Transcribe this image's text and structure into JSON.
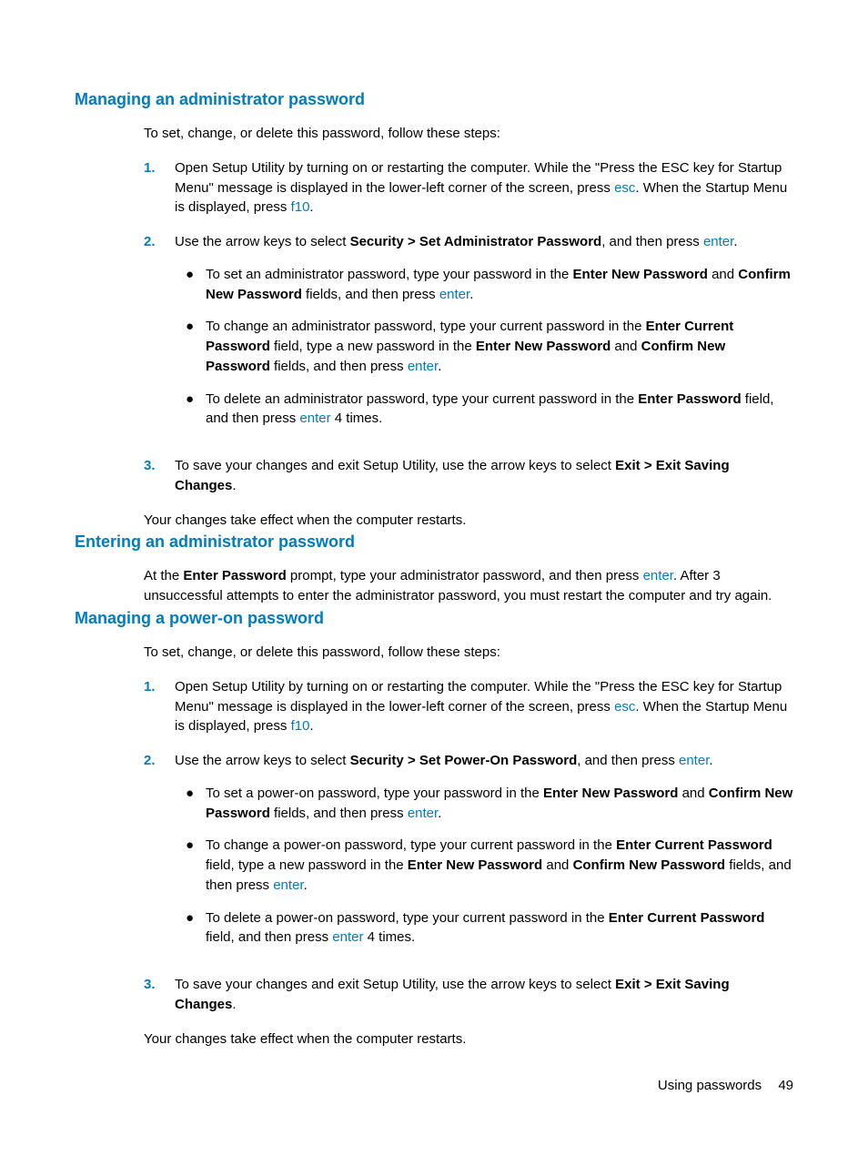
{
  "s1": {
    "title": "Managing an administrator password",
    "intro": "To set, change, or delete this password, follow these steps:",
    "m1": "1.",
    "m2": "2.",
    "m3": "3.",
    "step1_a": "Open Setup Utility by turning on or restarting the computer. While the \"Press the ESC key for Startup Menu\" message is displayed in the lower-left corner of the screen, press ",
    "step1_k1": "esc",
    "step1_b": ". When the Startup Menu is displayed, press ",
    "step1_k2": "f10",
    "step1_c": ".",
    "step2_a": "Use the arrow keys to select ",
    "step2_bold": "Security > Set Administrator Password",
    "step2_b": ", and then press ",
    "step2_k": "enter",
    "step2_c": ".",
    "b1_a": "To set an administrator password, type your password in the ",
    "b1_bold1": "Enter New Password",
    "b1_b": " and ",
    "b1_bold2": "Confirm New Password",
    "b1_c": " fields, and then press ",
    "b1_k": "enter",
    "b1_d": ".",
    "b2_a": "To change an administrator password, type your current password in the ",
    "b2_bold1": "Enter Current Password",
    "b2_b": " field, type a new password in the ",
    "b2_bold2": "Enter New Password",
    "b2_c": " and ",
    "b2_bold3": "Confirm New Password",
    "b2_d": " fields, and then press ",
    "b2_k": "enter",
    "b2_e": ".",
    "b3_a": "To delete an administrator password, type your current password in the ",
    "b3_bold": "Enter Password",
    "b3_b": " field, and then press ",
    "b3_k": "enter",
    "b3_c": " 4 times.",
    "step3_a": "To save your changes and exit Setup Utility, use the arrow keys to select ",
    "step3_bold": "Exit > Exit Saving Changes",
    "step3_b": ".",
    "outro": "Your changes take effect when the computer restarts."
  },
  "s2": {
    "title": "Entering an administrator password",
    "p_a": "At the ",
    "p_bold": "Enter Password",
    "p_b": " prompt, type your administrator password, and then press ",
    "p_k": "enter",
    "p_c": ". After 3 unsuccessful attempts to enter the administrator password, you must restart the computer and try again."
  },
  "s3": {
    "title": "Managing a power-on password",
    "intro": "To set, change, or delete this password, follow these steps:",
    "m1": "1.",
    "m2": "2.",
    "m3": "3.",
    "step1_a": "Open Setup Utility by turning on or restarting the computer. While the \"Press the ESC key for Startup Menu\" message is displayed in the lower-left corner of the screen, press ",
    "step1_k1": "esc",
    "step1_b": ". When the Startup Menu is displayed, press ",
    "step1_k2": "f10",
    "step1_c": ".",
    "step2_a": "Use the arrow keys to select ",
    "step2_bold": "Security > Set Power-On Password",
    "step2_b": ", and then press ",
    "step2_k": "enter",
    "step2_c": ".",
    "b1_a": "To set a power-on password, type your password in the ",
    "b1_bold1": "Enter New Password",
    "b1_b": " and ",
    "b1_bold2": "Confirm New Password",
    "b1_c": " fields, and then press ",
    "b1_k": "enter",
    "b1_d": ".",
    "b2_a": "To change a power-on password, type your current password in the ",
    "b2_bold1": "Enter Current Password",
    "b2_b": " field, type a new password in the ",
    "b2_bold2": "Enter New Password",
    "b2_c": " and ",
    "b2_bold3": "Confirm New Password",
    "b2_d": " fields, and then press ",
    "b2_k": "enter",
    "b2_e": ".",
    "b3_a": "To delete a power-on password, type your current password in the ",
    "b3_bold": "Enter Current Password",
    "b3_b": " field, and then press ",
    "b3_k": "enter",
    "b3_c": " 4 times.",
    "step3_a": "To save your changes and exit Setup Utility, use the arrow keys to select ",
    "step3_bold": "Exit > Exit Saving Changes",
    "step3_b": ".",
    "outro": "Your changes take effect when the computer restarts."
  },
  "footer": {
    "label": "Using passwords",
    "page": "49"
  },
  "bullet": "●"
}
